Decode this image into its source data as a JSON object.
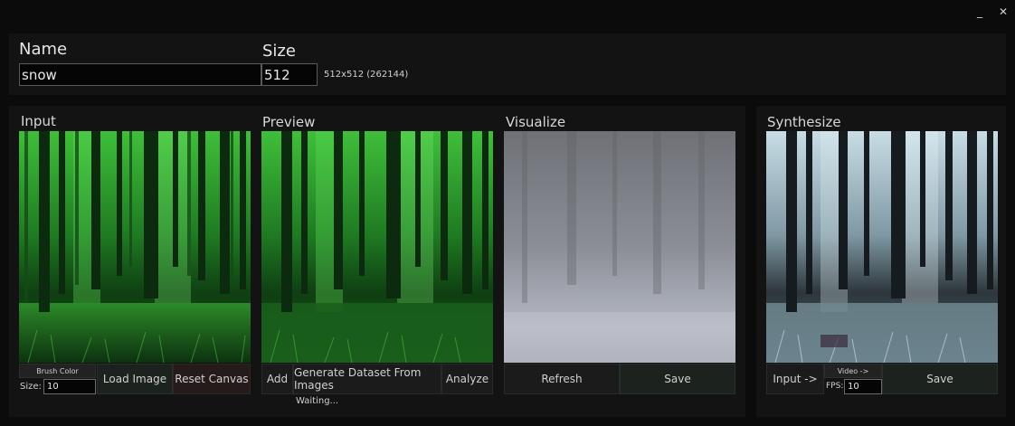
{
  "window": {
    "minimize_glyph": "_",
    "close_glyph": "✕"
  },
  "header": {
    "name_label": "Name",
    "name_value": "snow",
    "size_label": "Size",
    "size_value": "512",
    "size_info": "512x512 (262144)"
  },
  "input": {
    "title": "Input",
    "brush_color_label": "Brush Color",
    "size_label": "Size:",
    "size_value": "10",
    "load_image_label": "Load Image",
    "reset_canvas_label": "Reset Canvas"
  },
  "preview": {
    "title": "Preview",
    "add_label": "Add",
    "generate_label": "Generate Dataset From Images",
    "analyze_label": "Analyze",
    "status": "Waiting..."
  },
  "visualize": {
    "title": "Visualize",
    "refresh_label": "Refresh",
    "save_label": "Save"
  },
  "synthesize": {
    "title": "Synthesize",
    "input_label": "Input ->",
    "video_label": "Video ->",
    "fps_label": "FPS:",
    "fps_value": "10",
    "save_label": "Save"
  },
  "colors": {
    "background": "#0b0b0b",
    "panel": "#131313",
    "forest_green": "#2e8a2a",
    "snow_blue": "#a9c3cf",
    "fog_gray": "#8a8d94"
  }
}
